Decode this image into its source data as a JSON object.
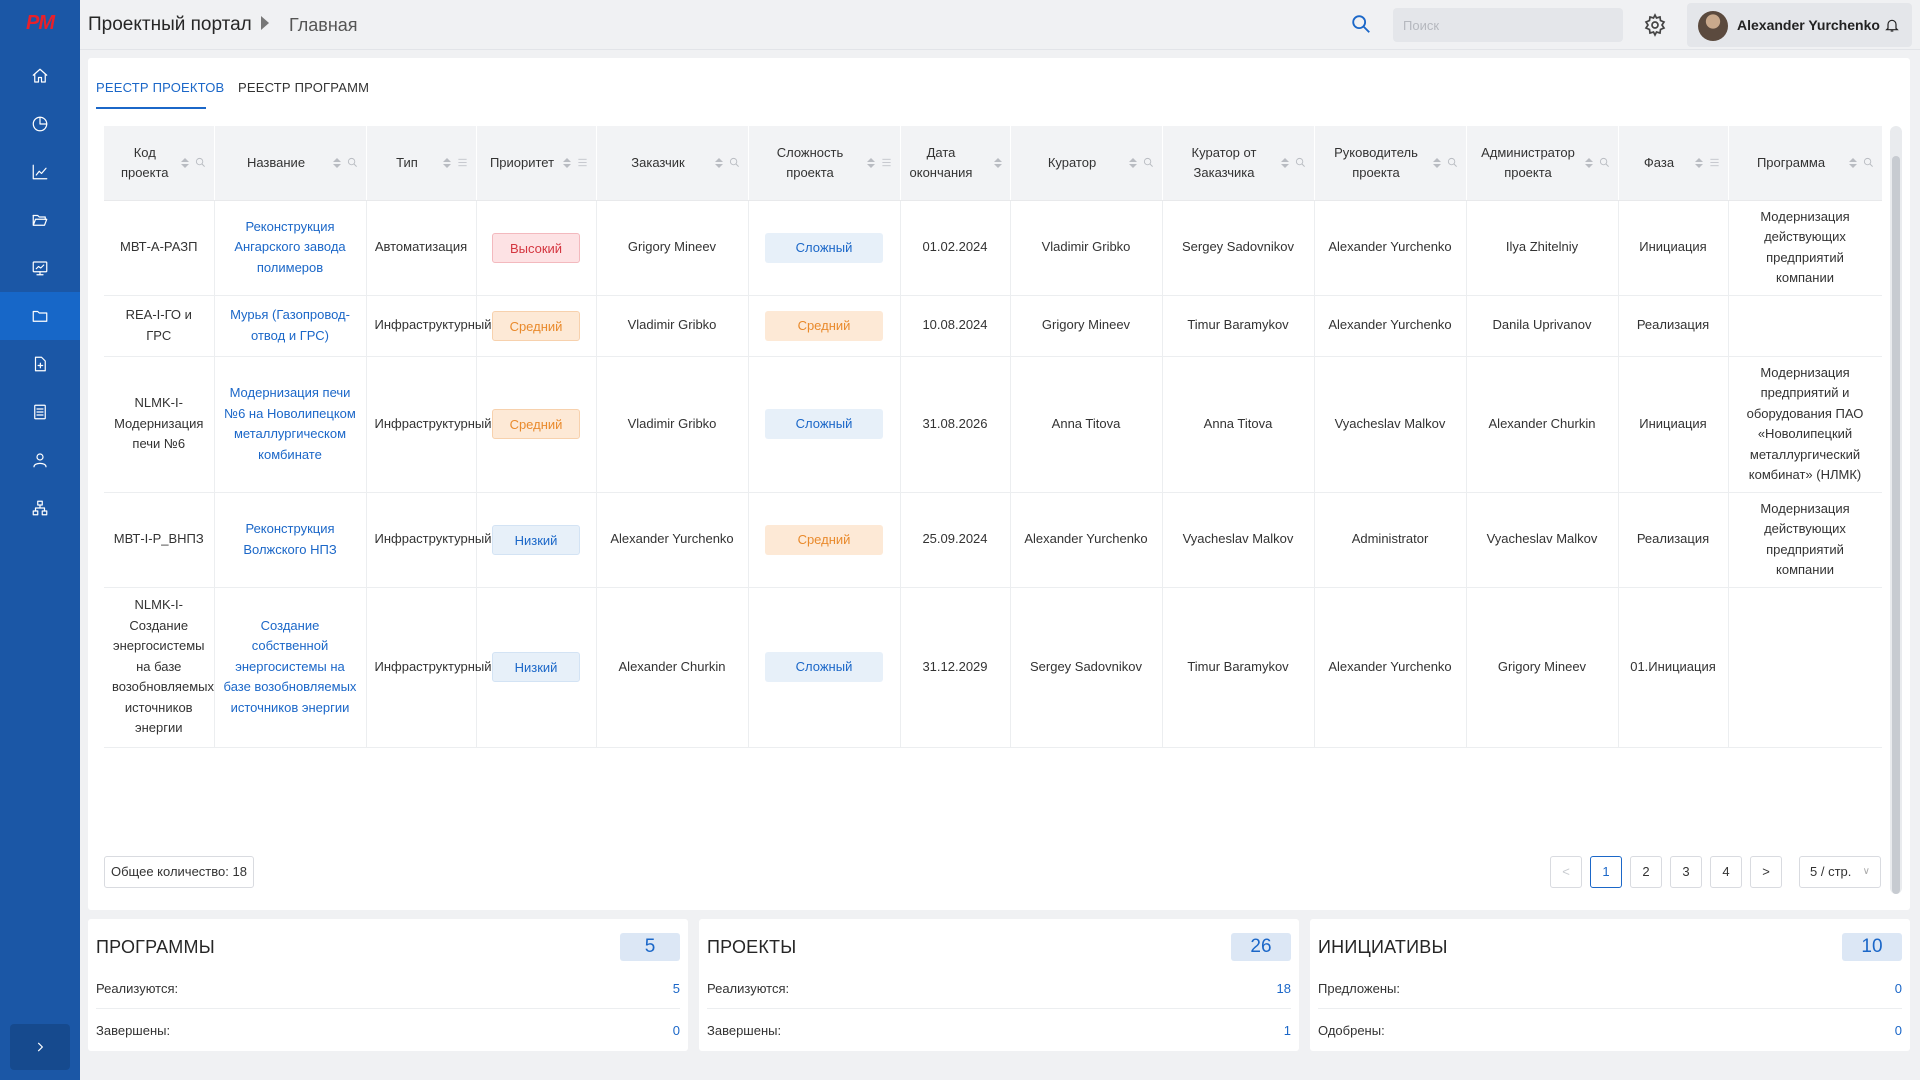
{
  "app": {
    "logo": "PM",
    "portal_title": "Проектный портал",
    "breadcrumb_current": "Главная"
  },
  "header": {
    "search_placeholder": "Поиск",
    "user_name": "Alexander Yurchenko"
  },
  "sidebar": {
    "items": [
      "home-icon",
      "pie-chart-icon",
      "bar-chart-icon",
      "folder-open-icon",
      "monitor-chart-icon",
      "folder-icon",
      "add-document-icon",
      "list-icon",
      "user-icon",
      "org-structure-icon"
    ],
    "active_index": 5
  },
  "tabs": [
    {
      "label": "РЕЕСТР ПРОЕКТОВ",
      "active": true
    },
    {
      "label": "РЕЕСТР ПРОГРАММ",
      "active": false
    }
  ],
  "table": {
    "columns": [
      {
        "label": "Код проекта",
        "search": true,
        "filter": false
      },
      {
        "label": "Название",
        "search": true,
        "filter": false
      },
      {
        "label": "Тип",
        "search": false,
        "filter": true
      },
      {
        "label": "Приоритет",
        "search": false,
        "filter": true
      },
      {
        "label": "Заказчик",
        "search": true,
        "filter": false
      },
      {
        "label": "Сложность проекта",
        "search": false,
        "filter": true
      },
      {
        "label": "Дата окончания",
        "search": false,
        "filter": false
      },
      {
        "label": "Куратор",
        "search": true,
        "filter": false
      },
      {
        "label": "Куратор от Заказчика",
        "search": true,
        "filter": false
      },
      {
        "label": "Руководитель проекта",
        "search": true,
        "filter": false
      },
      {
        "label": "Администратор проекта",
        "search": true,
        "filter": false
      },
      {
        "label": "Фаза",
        "search": false,
        "filter": true
      },
      {
        "label": "Программа",
        "search": true,
        "filter": false
      }
    ],
    "rows": [
      {
        "code": "МВТ-А-РАЗП",
        "name": "Реконструкция Ангарского завода полимеров",
        "type": "Автоматизация",
        "priority": "Высокий",
        "priority_level": "high",
        "customer": "Grigory Mineev",
        "complexity": "Сложный",
        "complexity_level": "hard",
        "end_date": "01.02.2024",
        "curator": "Vladimir Gribko",
        "customer_curator": "Sergey Sadovnikov",
        "manager": "Alexander Yurchenko",
        "admin": "Ilya Zhitelniy",
        "phase": "Инициация",
        "program": "Модернизация действующих предприятий компании"
      },
      {
        "code": "REA-I-ГО и ГРС",
        "name": "Мурья (Газопровод-отвод и ГРС)",
        "type": "Инфраструктурный",
        "priority": "Средний",
        "priority_level": "mid",
        "customer": "Vladimir Gribko",
        "complexity": "Средний",
        "complexity_level": "mid",
        "end_date": "10.08.2024",
        "curator": "Grigory Mineev",
        "customer_curator": "Timur Baramykov",
        "manager": "Alexander Yurchenko",
        "admin": "Danila Uprivanov",
        "phase": "Реализация",
        "program": ""
      },
      {
        "code": "NLMK-I-Модернизация печи №6",
        "name": "Модернизация печи №6 на Новолипецком металлургическом комбинате",
        "type": "Инфраструктурный",
        "priority": "Средний",
        "priority_level": "mid",
        "customer": "Vladimir Gribko",
        "complexity": "Сложный",
        "complexity_level": "hard",
        "end_date": "31.08.2026",
        "curator": "Anna Titova",
        "customer_curator": "Anna Titova",
        "manager": "Vyacheslav Malkov",
        "admin": "Alexander Churkin",
        "phase": "Инициация",
        "program": "Модернизация предприятий и оборудования ПАО «Новолипецкий металлургический комбинат» (НЛМК)"
      },
      {
        "code": "МВТ-I-Р_ВНПЗ",
        "name": "Реконструкция Волжского НПЗ",
        "type": "Инфраструктурный",
        "priority": "Низкий",
        "priority_level": "low",
        "customer": "Alexander Yurchenko",
        "complexity": "Средний",
        "complexity_level": "mid",
        "end_date": "25.09.2024",
        "curator": "Alexander Yurchenko",
        "customer_curator": "Vyacheslav Malkov",
        "manager": "Administrator",
        "admin": "Vyacheslav Malkov",
        "phase": "Реализация",
        "program": "Модернизация действующих предприятий компании"
      },
      {
        "code": "NLMK-I-Создание энергосистемы на базе возобновляемых источников энергии",
        "name": "Создание собственной энергосистемы на базе возобновляемых источников энергии",
        "type": "Инфраструктурный",
        "priority": "Низкий",
        "priority_level": "low",
        "customer": "Alexander Churkin",
        "complexity": "Сложный",
        "complexity_level": "hard",
        "end_date": "31.12.2029",
        "curator": "Sergey Sadovnikov",
        "customer_curator": "Timur Baramykov",
        "manager": "Alexander Yurchenko",
        "admin": "Grigory Mineev",
        "phase": "01.Инициация",
        "program": ""
      }
    ]
  },
  "pagination": {
    "total_label": "Общее количество: 18",
    "pages": [
      "1",
      "2",
      "3",
      "4"
    ],
    "current": "1",
    "prev": "<",
    "next": ">",
    "page_size": "5 / стр."
  },
  "summary": [
    {
      "title": "ПРОГРАММЫ",
      "count": "5",
      "rows": [
        {
          "label": "Реализуются:",
          "value": "5"
        },
        {
          "label": "Завершены:",
          "value": "0"
        }
      ]
    },
    {
      "title": "ПРОЕКТЫ",
      "count": "26",
      "rows": [
        {
          "label": "Реализуются:",
          "value": "18"
        },
        {
          "label": "Завершены:",
          "value": "1"
        }
      ]
    },
    {
      "title": "ИНИЦИАТИВЫ",
      "count": "10",
      "rows": [
        {
          "label": "Предложены:",
          "value": "0"
        },
        {
          "label": "Одобрены:",
          "value": "0"
        }
      ]
    }
  ],
  "colors": {
    "sidebar": "#1b57a6",
    "accent": "#1b67c8",
    "priority_high": "#d4353f",
    "priority_mid": "#e98a2c"
  }
}
